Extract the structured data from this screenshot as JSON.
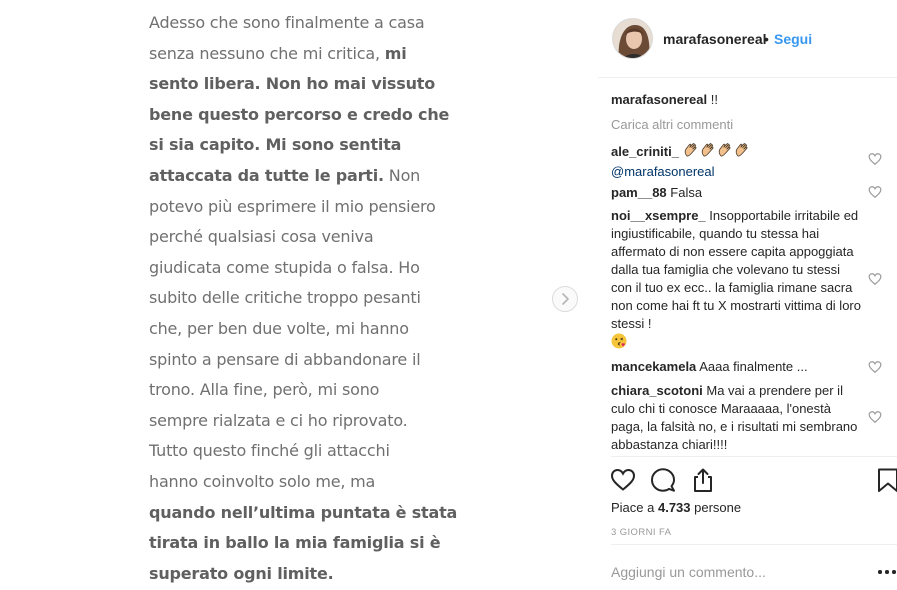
{
  "post": {
    "lines": [
      [
        {
          "t": "Adesso che sono finalmente a casa"
        }
      ],
      [
        {
          "t": "senza nessuno che mi critica, "
        },
        {
          "t": "mi",
          "bold": true
        }
      ],
      [
        {
          "t": "sento libera. Non ho mai vissuto",
          "bold": true
        }
      ],
      [
        {
          "t": "bene questo percorso e credo che",
          "bold": true
        }
      ],
      [
        {
          "t": "si sia capito. Mi sono sentita",
          "bold": true
        }
      ],
      [
        {
          "t": "attaccata da tutte le parti.",
          "bold": true
        },
        {
          "t": " Non"
        }
      ],
      [
        {
          "t": "potevo più esprimere il mio pensiero"
        }
      ],
      [
        {
          "t": "perché qualsiasi cosa veniva"
        }
      ],
      [
        {
          "t": "giudicata come stupida o falsa. Ho"
        }
      ],
      [
        {
          "t": "subito delle critiche troppo pesanti"
        }
      ],
      [
        {
          "t": "che, per ben due volte, mi hanno"
        }
      ],
      [
        {
          "t": "spinto a pensare di abbandonare il"
        }
      ],
      [
        {
          "t": "trono. Alla fine, però, mi sono"
        }
      ],
      [
        {
          "t": "sempre rialzata e ci ho riprovato."
        }
      ],
      [
        {
          "t": "Tutto questo finché gli attacchi"
        }
      ],
      [
        {
          "t": "hanno coinvolto solo me, ma"
        }
      ],
      [
        {
          "t": "quando nell’ultima puntata è stata",
          "bold": true
        }
      ],
      [
        {
          "t": "tirata in ballo la mia famiglia si è",
          "bold": true
        }
      ],
      [
        {
          "t": "superato ogni limite.",
          "bold": true
        }
      ]
    ],
    "next_icon": "chevron-right-icon"
  },
  "header": {
    "username": "marafasonereal",
    "separator": "•",
    "follow_label": "Segui"
  },
  "caption": {
    "username": "marafasonereal",
    "text": "!!"
  },
  "load_more_label": "Carica altri commenti",
  "comments": [
    {
      "username": "ale_criniti_",
      "emoji_count": 4,
      "emoji_name": "clapping-hands-icon",
      "mention": "@marafasonereal"
    },
    {
      "username": "pam__88",
      "text": "Falsa"
    },
    {
      "username": "noi__xsempre_",
      "text": "Insopportabile irritabile ed ingiustificabile, quando tu stessa hai affermato di non essere capita appoggiata dalla tua famiglia che volevano tu stessi con il tuo ex ecc.. la famiglia rimane sacra non come hai ft tu X mostrarti vittima di loro stessi !",
      "emoji_name": "kissing-face-icon"
    },
    {
      "username": "mancekamela",
      "text": "Aaaa finalmente ..."
    },
    {
      "username": "chiara_scotoni",
      "text": "Ma vai a prendere per il culo chi ti conosce Maraaaaa, l'onestà paga, la falsità no, e i risultati mi sembrano abbastanza chiari!!!!"
    }
  ],
  "actions": {
    "icons": [
      "heart-icon",
      "comment-icon",
      "share-icon",
      "bookmark-icon"
    ]
  },
  "likes": {
    "prefix": "Piace a ",
    "count": "4.733",
    "suffix": " persone"
  },
  "time_ago": "3 GIORNI FA",
  "comment_box": {
    "placeholder": "Aggiungi un commento..."
  },
  "colors": {
    "link": "#3897f0",
    "text": "#262626",
    "muted": "#999999",
    "mention": "#003569",
    "post_text": "#707070"
  }
}
